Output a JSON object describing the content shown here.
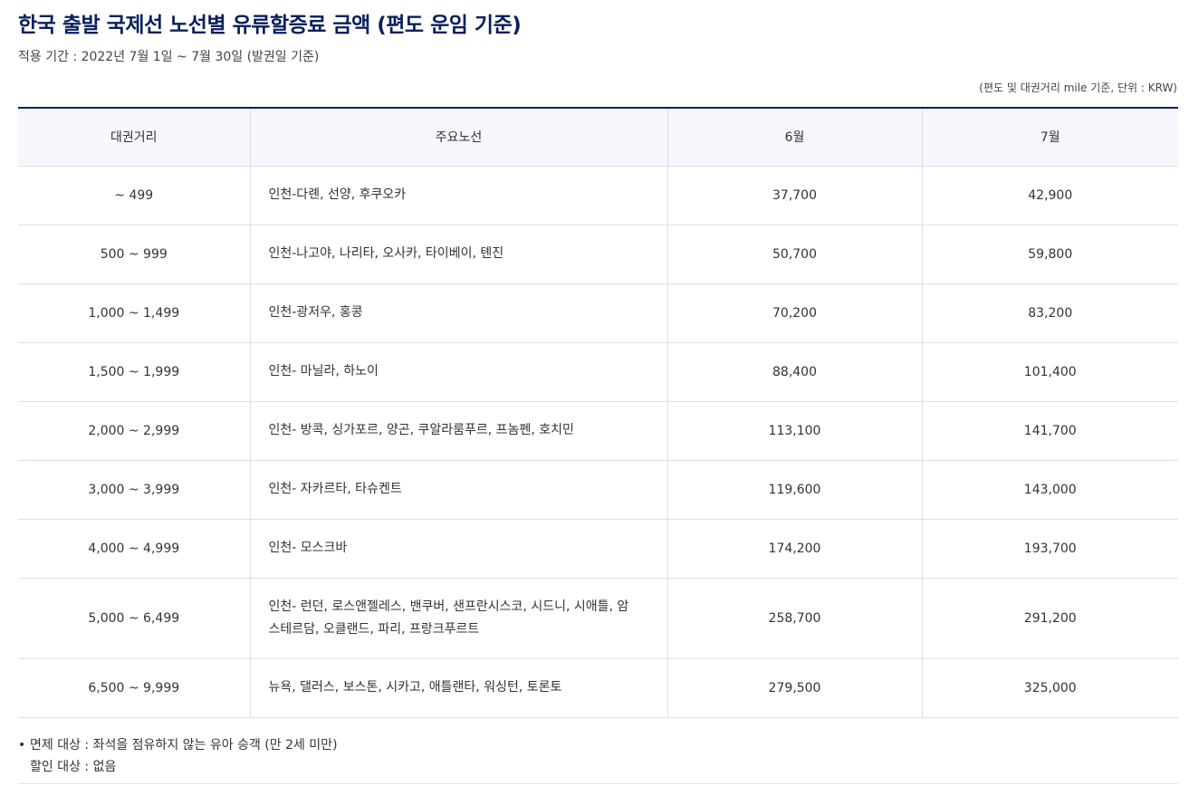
{
  "title": "한국 출발 국제선 노선별 유류할증료 금액 (편도 운임 기준)",
  "period": "적용 기간 : 2022년 7월 1일 ~ 7월 30일 (발권일 기준)",
  "unit_note": "(편도 및 대권거리 mile 기준, 단위 : KRW)",
  "table": {
    "headers": [
      "대권거리",
      "주요노선",
      "6월",
      "7월"
    ],
    "rows": [
      {
        "distance": "~ 499",
        "routes": "인천-다롄, 선양, 후쿠오카",
        "june": "37,700",
        "july": "42,900"
      },
      {
        "distance": "500 ~ 999",
        "routes": "인천-나고야, 나리타, 오사카, 타이베이, 톈진",
        "june": "50,700",
        "july": "59,800"
      },
      {
        "distance": "1,000 ~ 1,499",
        "routes": "인천-광저우, 홍콩",
        "june": "70,200",
        "july": "83,200"
      },
      {
        "distance": "1,500 ~ 1,999",
        "routes": "인천- 마닐라, 하노이",
        "june": "88,400",
        "july": "101,400"
      },
      {
        "distance": "2,000 ~ 2,999",
        "routes": "인천- 방콕, 싱가포르, 양곤, 쿠알라룸푸르, 프놈펜, 호치민",
        "june": "113,100",
        "july": "141,700"
      },
      {
        "distance": "3,000 ~ 3,999",
        "routes": "인천- 자카르타, 타슈켄트",
        "june": "119,600",
        "july": "143,000"
      },
      {
        "distance": "4,000 ~ 4,999",
        "routes": "인천- 모스크바",
        "june": "174,200",
        "july": "193,700"
      },
      {
        "distance": "5,000 ~ 6,499",
        "routes": "인천- 런던, 로스앤젤레스, 밴쿠버, 샌프란시스코, 시드니, 시애틀, 암스테르담, 오클랜드, 파리, 프랑크푸르트",
        "june": "258,700",
        "july": "291,200"
      },
      {
        "distance": "6,500 ~ 9,999",
        "routes": "뉴욕, 댈러스, 보스톤, 시카고, 애틀랜타, 워싱턴, 토론토",
        "june": "279,500",
        "july": "325,000"
      }
    ]
  },
  "notes": {
    "bullet": "•",
    "exempt": "면제 대상 : 좌석을 점유하지 않는 유아 승객 (만 2세 미만)",
    "discount": "할인 대상 : 없음"
  }
}
